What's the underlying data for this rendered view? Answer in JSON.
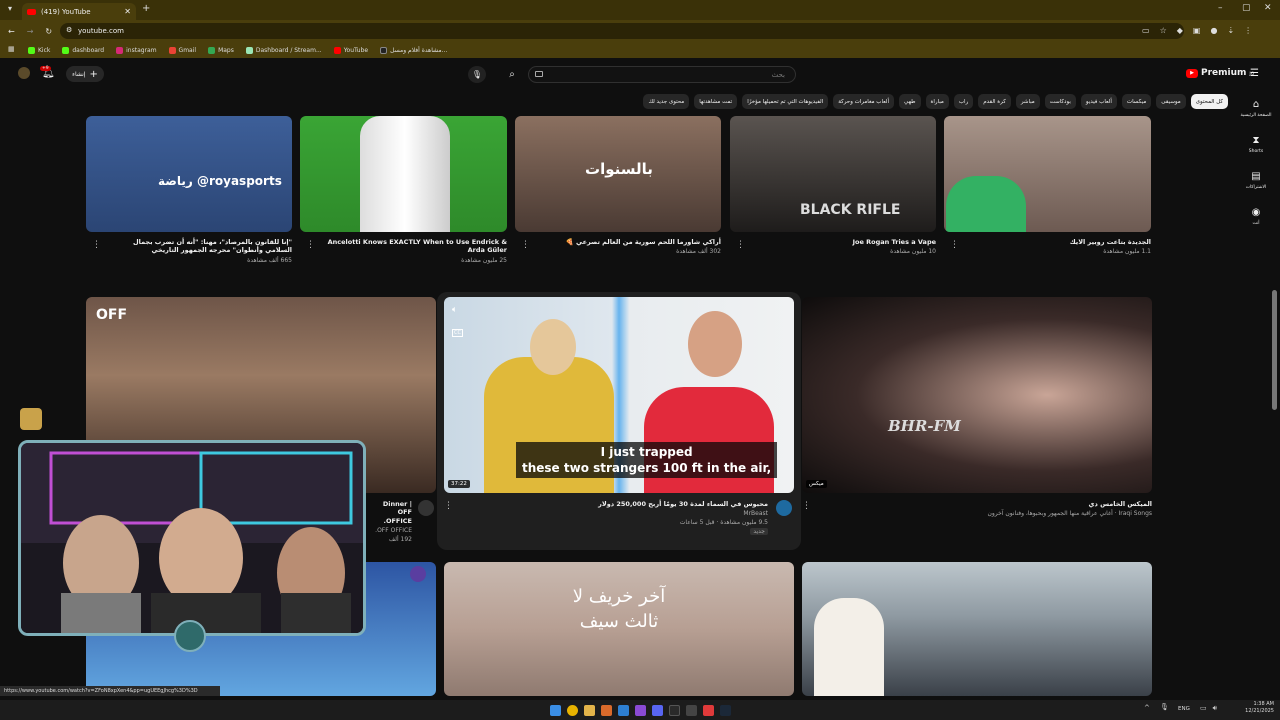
{
  "browser": {
    "tab_title": "(419) YouTube",
    "url": "youtube.com",
    "bookmarks": [
      "Kick",
      "dashboard",
      "instagram",
      "Gmail",
      "Maps",
      "Dashboard / Stream...",
      "YouTube",
      "مشاهدة أفلام ومسل..."
    ]
  },
  "header": {
    "search_placeholder": "بحث",
    "create_label": "إنشاء",
    "notif_count": "+9",
    "logo_text": "Premium",
    "logo_sup": "JO"
  },
  "chips": [
    "كل المحتوى",
    "موسيقى",
    "ميكسات",
    "ألعاب فيديو",
    "بودكاست",
    "مباشر",
    "كرة القدم",
    "راب",
    "مباراة",
    "طهي",
    "ألعاب مغامرات وحركة",
    "الفيديوهات التي تم تحميلها مؤخرًا",
    "تمت مشاهدتها",
    "محتوى جديد لك"
  ],
  "sidebar": [
    {
      "icon": "home-icon",
      "label": "الصفحة الرئيسية"
    },
    {
      "icon": "shorts-icon",
      "label": "Shorts"
    },
    {
      "icon": "subscriptions-icon",
      "label": "الاشتراكات"
    },
    {
      "icon": "you-icon",
      "label": "أنت"
    }
  ],
  "row1": [
    {
      "title": "\"إنا للقانون بالمرصاد\"، مهنا: \"أنه أن تضرب بجمال السلامي وأنطوان\" محرجه الجمهور التاريخي",
      "views": "665 ألف مشاهدة",
      "thumb_text": "رياضة @royasports"
    },
    {
      "title": "Ancelotti Knows EXACTLY When to Use Endrick & Arda Güler",
      "views": "25 مليون مشاهدة"
    },
    {
      "title": "أراكي شاورما اللحم سورية من العالم تصرعي 🍕",
      "views": "302 ألف مشاهدة",
      "thumb_text": "بالسنوات"
    },
    {
      "title": "Joe Rogan Tries a Vape",
      "views": "10 مليون مشاهدة",
      "thumb_text": "BLACK RIFLE"
    },
    {
      "title": "الجديدة بتاعت روبير الايك",
      "views": "1.1 مليون مشاهدة"
    }
  ],
  "row2": [
    {
      "title": "Dinner | OFF OFFICE.",
      "channel": "OFF OFFICE.",
      "views": "192 ألف",
      "thumb_text": "OFF"
    },
    {
      "title": "محبوس في السماء لمدة 30 يومًا أربح 250,000 دولار",
      "channel": "MrBeast",
      "views": "9.5 مليون مشاهدة · قبل 5 ساعات",
      "badge": "جديد",
      "duration": "37:22",
      "caption_line1": "I just trapped",
      "caption_line2": "these two strangers 100 ft in the air,"
    },
    {
      "title": "الميكس الخامس دي",
      "channel": "Iraqi Songs · أغاني عراقية منها الجمهور وبحبوها، وفنانون آخرون",
      "badge": "ميكس",
      "thumb_text": "BHR-FM"
    }
  ],
  "row3": [
    {
      "thumb_text": "آخر خريف لا ثالث سيف"
    }
  ],
  "status_url": "https://www.youtube.com/watch?v=ZFoN8xpXen4&pp=ugUEEgJhcg%3D%3D",
  "tray": {
    "lang": "ENG",
    "time": "1:38 AM",
    "date": "12/21/2025"
  },
  "colors": {
    "brand": "#ff0000",
    "chrome": "#4a3e0c",
    "bg": "#0f0f0f"
  }
}
